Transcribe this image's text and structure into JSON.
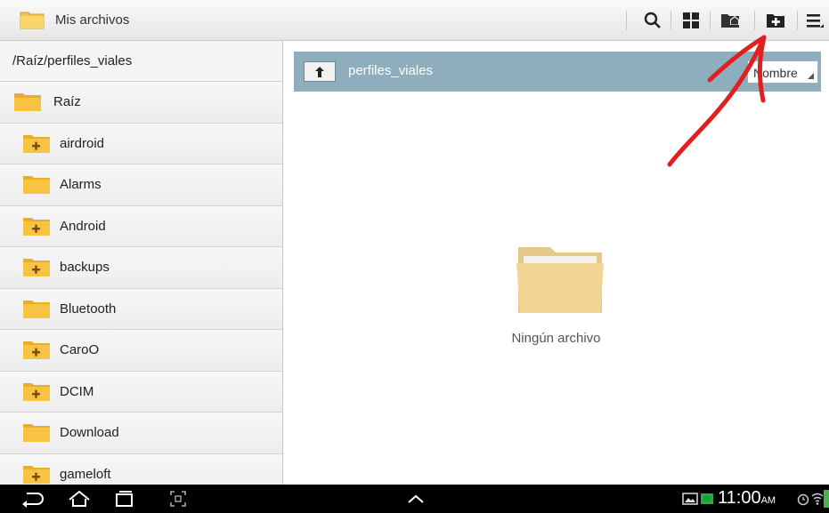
{
  "app": {
    "title": "Mis archivos"
  },
  "toolbar": {
    "buttons": [
      "search-icon",
      "view-grid-icon",
      "home-folder-icon",
      "new-folder-icon",
      "menu-icon"
    ]
  },
  "left_panel": {
    "path": "/Raíz/perfiles_viales",
    "root_label": "Raíz",
    "folders": [
      {
        "label": "airdroid",
        "has_children": true
      },
      {
        "label": "Alarms",
        "has_children": false
      },
      {
        "label": "Android",
        "has_children": true
      },
      {
        "label": "backups",
        "has_children": true
      },
      {
        "label": "Bluetooth",
        "has_children": false
      },
      {
        "label": "CaroO",
        "has_children": true
      },
      {
        "label": "DCIM",
        "has_children": true
      },
      {
        "label": "Download",
        "has_children": false
      },
      {
        "label": "gameloft",
        "has_children": true
      }
    ]
  },
  "right_panel": {
    "current_folder": "perfiles_viales",
    "sort_label": "Nombre",
    "empty_message": "Ningún archivo"
  },
  "statusbar": {
    "time": "11:00",
    "ampm": "AM"
  },
  "colors": {
    "folder": "#f6c343",
    "header_bar": "#8faebd",
    "annotation": "#e02020"
  }
}
